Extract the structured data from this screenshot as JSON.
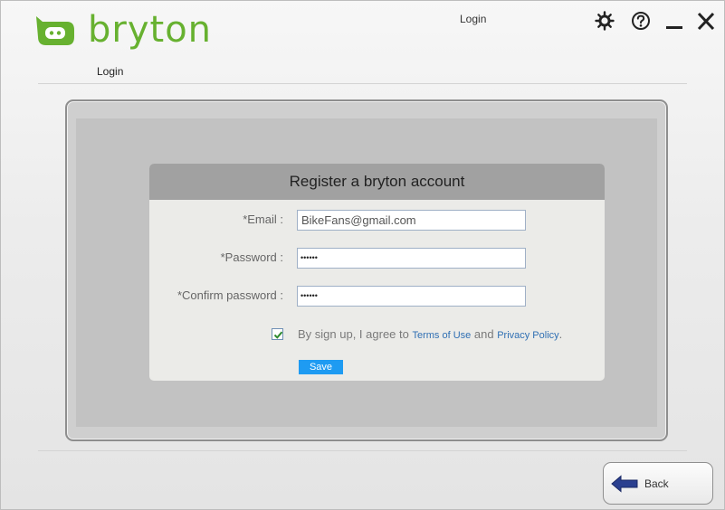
{
  "app": {
    "logo_text": "bryton",
    "page_subtitle": "Login",
    "window_title": "Login"
  },
  "window_controls": {
    "settings_icon": "gear-icon",
    "help_icon": "help-icon",
    "minimize_icon": "minimize-icon",
    "close_icon": "close-icon"
  },
  "dialog": {
    "title": "Register a bryton account",
    "fields": {
      "email": {
        "label": "*Email :",
        "value": "BikeFans@gmail.com"
      },
      "password": {
        "label": "*Password :",
        "value": "••••••"
      },
      "confirm_password": {
        "label": "*Confirm password :",
        "value": "••••••"
      }
    },
    "agree": {
      "checked": true,
      "prefix": "By sign up, I agree to ",
      "terms_link": "Terms of Use",
      "conjunction": " and ",
      "privacy_link": "Privacy Policy",
      "suffix": "."
    },
    "save_label": "Save"
  },
  "footer": {
    "back_label": "Back"
  },
  "colors": {
    "brand_green": "#67b130",
    "save_blue": "#1e9bf2",
    "link_blue": "#2f6fb3",
    "back_arrow": "#2a3f8f"
  }
}
